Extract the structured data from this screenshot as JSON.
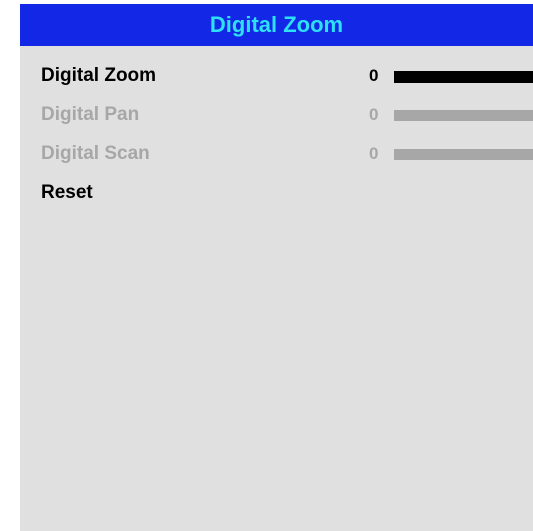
{
  "header": {
    "title": "Digital Zoom"
  },
  "menu": {
    "items": [
      {
        "label": "Digital Zoom",
        "value": "0",
        "level": 0,
        "enabled": true
      },
      {
        "label": "Digital Pan",
        "value": "0",
        "level": 0,
        "enabled": false
      },
      {
        "label": "Digital Scan",
        "value": "0",
        "level": 0,
        "enabled": false
      },
      {
        "label": "Reset",
        "enabled": true
      }
    ]
  },
  "colors": {
    "header_background": "#1327e6",
    "title_text": "#2ee0f5",
    "panel_background": "#e0e0e0",
    "enabled_text": "#000000",
    "disabled_text": "#a7a7a7"
  }
}
